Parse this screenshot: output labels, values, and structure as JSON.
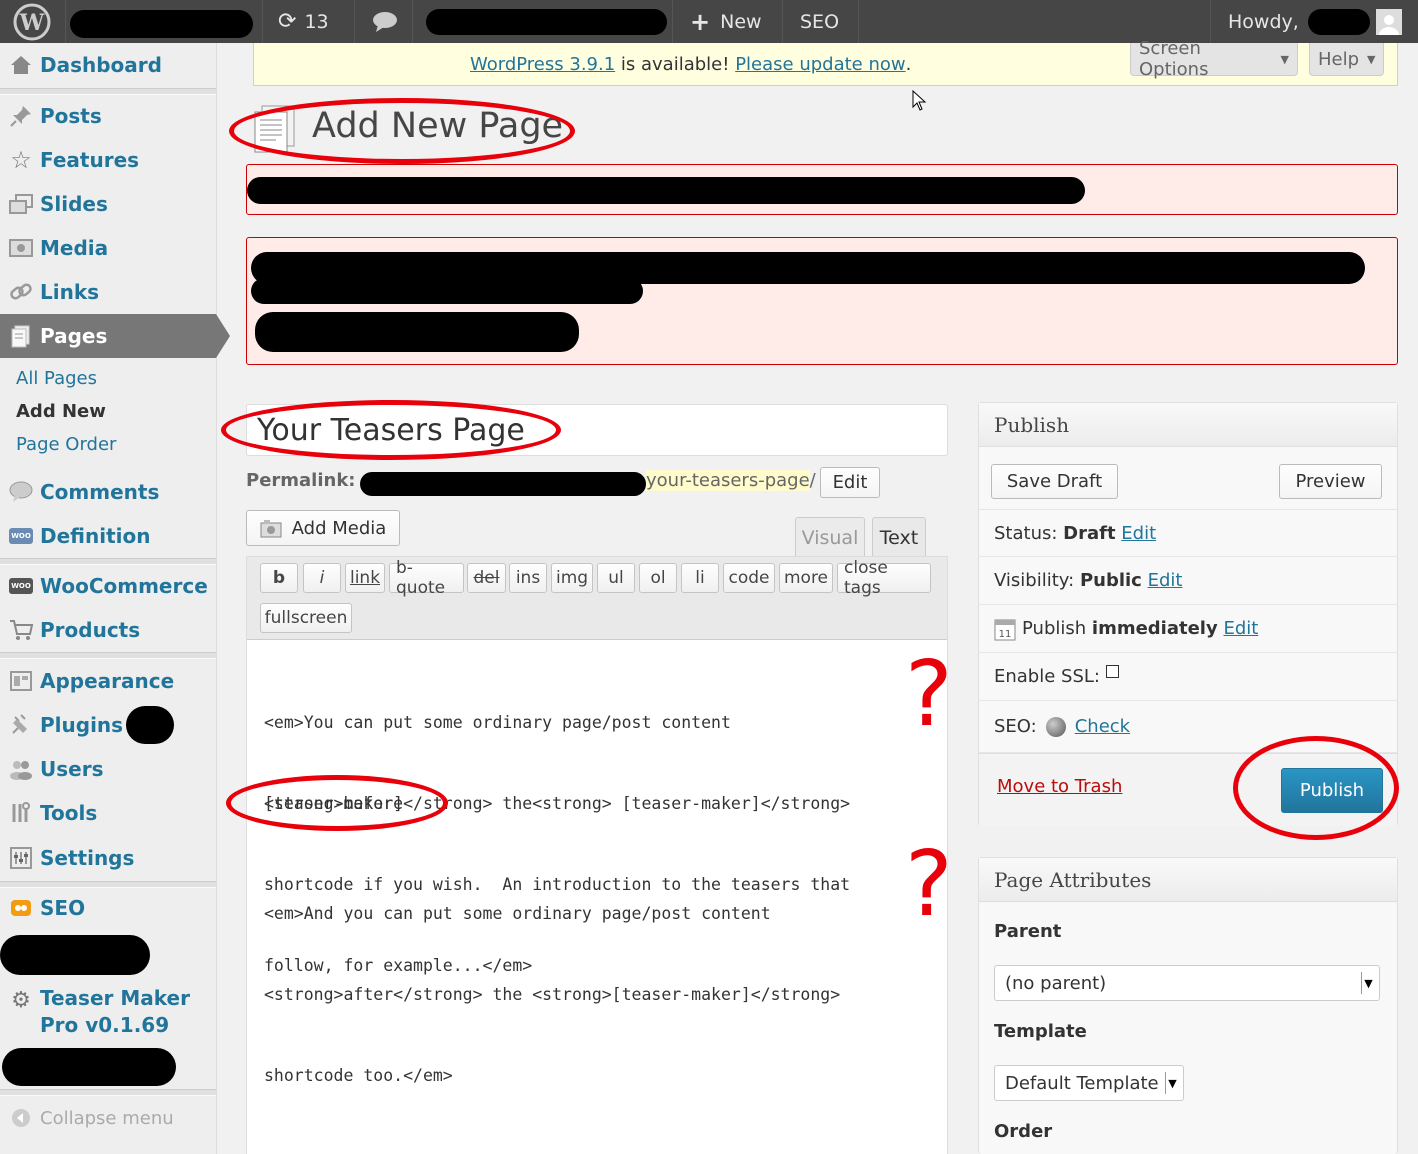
{
  "adminbar": {
    "updates_count": "13",
    "new_label": "New",
    "seo_label": "SEO",
    "howdy": "Howdy,"
  },
  "sidebar": {
    "dashboard": "Dashboard",
    "posts": "Posts",
    "features": "Features",
    "slides": "Slides",
    "media": "Media",
    "links": "Links",
    "pages": "Pages",
    "pages_sub": [
      "All Pages",
      "Add New",
      "Page Order"
    ],
    "comments": "Comments",
    "definition": "Definition",
    "woocommerce": "WooCommerce",
    "products": "Products",
    "appearance": "Appearance",
    "plugins": "Plugins",
    "users": "Users",
    "tools": "Tools",
    "settings": "Settings",
    "seo": "SEO",
    "teaser_maker_line1": "Teaser Maker",
    "teaser_maker_line2": "Pro v0.1.69",
    "collapse": "Collapse menu"
  },
  "notice": {
    "version_link": "WordPress 3.9.1",
    "middle": " is available! ",
    "update_link": "Please update now",
    "end": "."
  },
  "screen_options": "Screen Options",
  "help": "Help",
  "page_title": "Add New Page",
  "post_title": "Your Teasers Page",
  "permalink": {
    "label": "Permalink:",
    "slug": "your-teasers-page",
    "trail": "/",
    "edit": "Edit"
  },
  "add_media": "Add Media",
  "tabs": {
    "visual": "Visual",
    "text": "Text"
  },
  "quicktags": [
    "b",
    "i",
    "link",
    "b-quote",
    "del",
    "ins",
    "img",
    "ul",
    "ol",
    "li",
    "code",
    "more",
    "close tags",
    "fullscreen"
  ],
  "editor": {
    "para1": [
      "<em>You can put some ordinary page/post content",
      "<strong>before</strong> the<strong> [teaser-maker]</strong>",
      "shortcode if you wish.  An introduction to the teasers that",
      "follow, for example...</em>"
    ],
    "shortcode": "[teaser-maker]",
    "para2": [
      "<em>And you can put some ordinary page/post content",
      "<strong>after</strong> the <strong>[teaser-maker]</strong>",
      "shortcode too.</em>"
    ]
  },
  "publish": {
    "title": "Publish",
    "save_draft": "Save Draft",
    "preview": "Preview",
    "status_label": "Status:",
    "status_value": "Draft",
    "visibility_label": "Visibility:",
    "visibility_value": "Public",
    "publish_label": "Publish",
    "publish_value": "immediately",
    "edit": "Edit",
    "ssl_label": "Enable SSL:",
    "seo_label": "SEO:",
    "seo_check": "Check",
    "trash": "Move to Trash",
    "publish_button": "Publish"
  },
  "page_attributes": {
    "title": "Page Attributes",
    "parent_label": "Parent",
    "parent_value": "(no parent)",
    "template_label": "Template",
    "template_value": "Default Template",
    "order_label": "Order"
  },
  "annotations": {
    "question_mark": "?"
  },
  "colors": {
    "link": "#21759b",
    "annotation": "#e8000b",
    "publish": "#2a95c5"
  }
}
